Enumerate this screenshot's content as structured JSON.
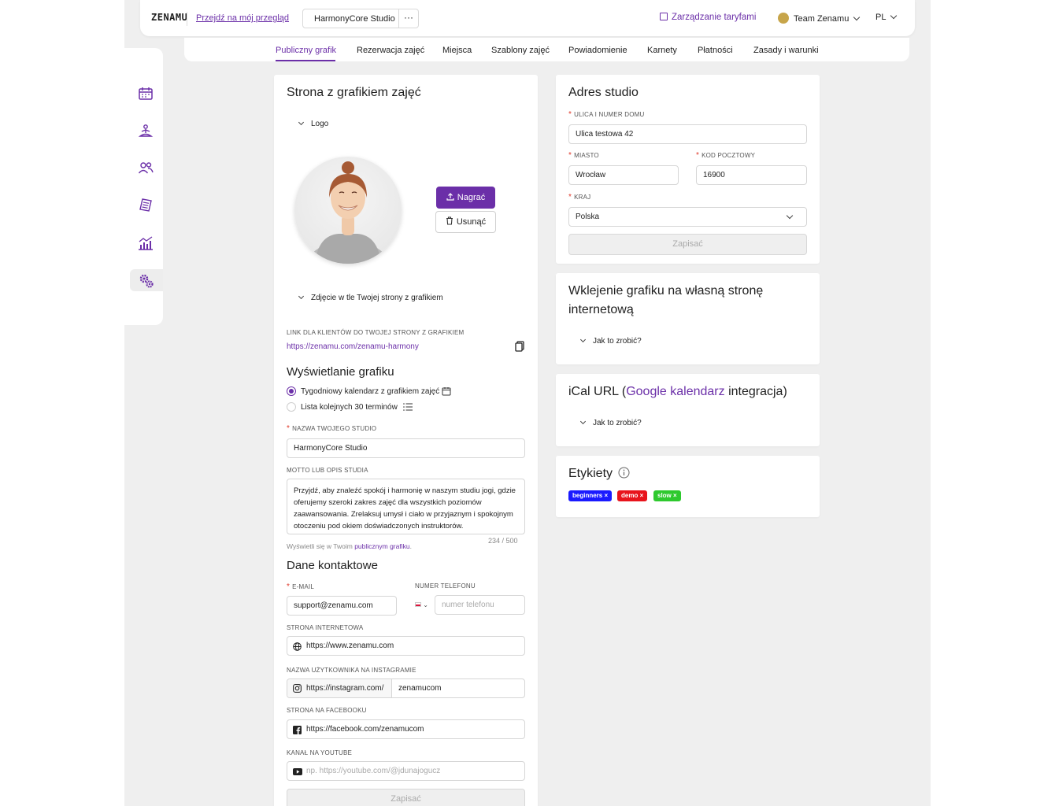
{
  "header": {
    "logo": "ZENAMU",
    "overview_link": "Przejdź na mój przegląd",
    "studio_name": "HarmonyCore Studio",
    "studio_menu": "···",
    "plans_link": "Zarządzanie taryfami",
    "team_name": "Team Zenamu",
    "language": "PL"
  },
  "tabs": [
    {
      "label": "Publiczny grafik",
      "active": true
    },
    {
      "label": "Rezerwacja zajęć"
    },
    {
      "label": "Miejsca"
    },
    {
      "label": "Szablony zajęć"
    },
    {
      "label": "Powiadomienie"
    },
    {
      "label": "Karnety"
    },
    {
      "label": "Płatności"
    },
    {
      "label": "Zasady i warunki"
    }
  ],
  "sidebar": {
    "items": [
      "calendar-icon",
      "meditation-icon",
      "users-icon",
      "receipt-icon",
      "stats-icon",
      "settings-icon"
    ],
    "active": "settings-icon"
  },
  "schedule_page": {
    "title": "Strona z grafikiem zajęć",
    "logo_section": "Logo",
    "upload_label": "Nagrać",
    "remove_label": "Usunąć",
    "background_section": "Zdjęcie w tle Twojej strony z grafikiem",
    "link_label": "LINK DLA KLIENTÓW DO TWOJEJ STRONY Z GRAFIKIEM",
    "link_value": "https://zenamu.com/zenamu-harmony",
    "display_title": "Wyświetlanie grafiku",
    "display_options": [
      {
        "label": "Tygodniowy kalendarz z grafikiem zajęć",
        "selected": true
      },
      {
        "label": "Lista kolejnych 30 terminów",
        "selected": false
      }
    ],
    "studio_name_label": "NAZWA TWOJEGO STUDIO",
    "studio_name_value": "HarmonyCore Studio",
    "motto_label": "MOTTO LUB OPIS STUDIA",
    "motto_value": "Przyjdź, aby znaleźć spokój i harmonię w naszym studiu jogi, gdzie oferujemy szeroki zakres zajęć dla wszystkich poziomów zaawansowania. Zrelaksuj umysł i ciało w przyjaznym i spokojnym otoczeniu pod okiem doświadczonych instruktorów.",
    "motto_counter": "234 / 500",
    "motto_hint_prefix": "Wyświetli się w Twoim ",
    "motto_hint_link": "publicznym grafiku",
    "motto_hint_suffix": ".",
    "contact_title": "Dane kontaktowe",
    "email_label": "E-MAIL",
    "email_value": "support@zenamu.com",
    "phone_label": "NUMER TELEFONU",
    "phone_placeholder": "numer telefonu",
    "website_label": "STRONA INTERNETOWA",
    "website_value": "https://www.zenamu.com",
    "instagram_label": "NAZWA UŻYTKOWNIKA NA INSTAGRAMIE",
    "instagram_prefix": "https://instagram.com/",
    "instagram_value": "zenamucom",
    "facebook_label": "STRONA NA FACEBOOKU",
    "facebook_value": "https://facebook.com/zenamucom",
    "youtube_label": "KANAŁ NA YOUTUBE",
    "youtube_placeholder": "np. https://youtube.com/@jdunajogucz",
    "save_label": "Zapisać"
  },
  "address": {
    "title": "Adres studio",
    "street_label": "ULICA I NUMER DOMU",
    "street_value": "Ulica testowa 42",
    "city_label": "MIASTO",
    "city_value": "Wrocław",
    "zip_label": "KOD POCZTOWY",
    "zip_value": "16900",
    "country_label": "KRAJ",
    "country_value": "Polska",
    "save_label": "Zapisać"
  },
  "embed": {
    "title": "Wklejenie grafiku na własną stronę internetową",
    "howto": "Jak to zrobić?"
  },
  "ical": {
    "title_prefix": "iCal URL (",
    "title_link": "Google kalendarz",
    "title_suffix": " integracja)",
    "howto": "Jak to zrobić?"
  },
  "labels": {
    "title": "Etykiety",
    "tags": [
      {
        "name": "beginners",
        "color": "#1a1aff"
      },
      {
        "name": "demo",
        "color": "#e8141c"
      },
      {
        "name": "slow",
        "color": "#2ec92e"
      }
    ]
  },
  "colors": {
    "accent": "#6b2fa8",
    "background": "#efefef"
  }
}
